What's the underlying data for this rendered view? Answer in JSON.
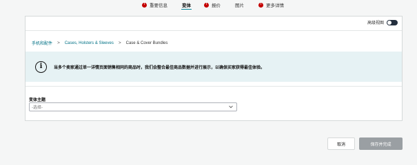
{
  "tabs": [
    {
      "label": "重要信息",
      "error": true,
      "error_mark": "!"
    },
    {
      "label": "变体",
      "error": false,
      "active": true
    },
    {
      "label": "报价",
      "error": true,
      "error_mark": "!"
    },
    {
      "label": "图片",
      "error": false
    },
    {
      "label": "更多详情",
      "error": true,
      "error_mark": "!"
    }
  ],
  "advanced_view": {
    "label": "高级视图",
    "enabled": true
  },
  "breadcrumb": [
    "手机和配件",
    "Cases, Holsters & Sleeves",
    "Case & Cover Bundles"
  ],
  "breadcrumb_separator": ">",
  "alert": {
    "icon": "info-icon",
    "icon_glyph": "i",
    "message": "当多个卖家通过单一详情页面销售相同的商品时，我们会整合最佳商品数据并进行展示，以确保买家获得最佳体验。"
  },
  "variation_theme": {
    "label": "变体主题",
    "placeholder": "-选择-"
  },
  "buttons": {
    "cancel": "取消",
    "save": "保存并完成"
  }
}
